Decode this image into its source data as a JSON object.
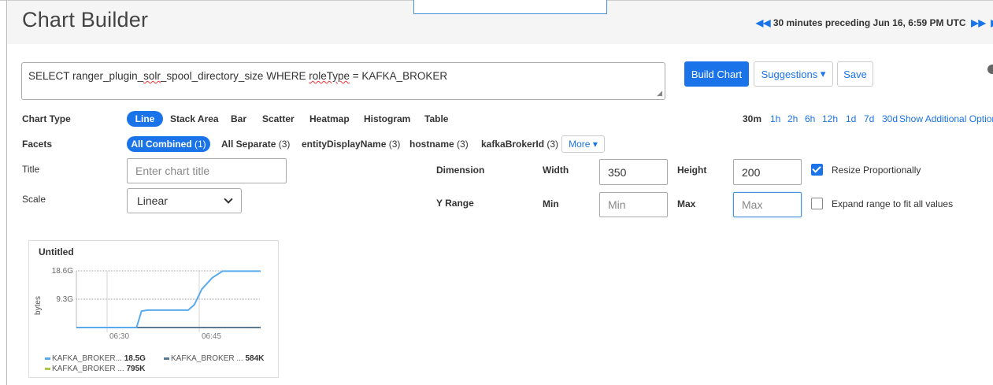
{
  "header": {
    "title": "Chart Builder",
    "time_range": "30 minutes preceding Jun 16, 6:59 PM UTC"
  },
  "query": {
    "before": "SELECT ranger_plugin_",
    "squig1": "solr",
    "middle": "_spool_directory_size WHERE ",
    "squig2": "roleType",
    "after": " = KAFKA_BROKER"
  },
  "toolbar": {
    "build_label": "Build Chart",
    "suggestions_label": "Suggestions",
    "save_label": "Save"
  },
  "chart_type": {
    "label": "Chart Type",
    "options": [
      "Line",
      "Stack Area",
      "Bar",
      "Scatter",
      "Heatmap",
      "Histogram",
      "Table"
    ],
    "selected": "Line"
  },
  "time_ranges": {
    "items": [
      "30m",
      "1h",
      "2h",
      "6h",
      "12h",
      "1d",
      "7d",
      "30d"
    ],
    "active": "30m",
    "more_label": "Show Additional Options"
  },
  "facets": {
    "label": "Facets",
    "items": [
      {
        "name": "All Combined",
        "count": "(1)"
      },
      {
        "name": "All Separate",
        "count": "(3)"
      },
      {
        "name": "entityDisplayName",
        "count": "(3)"
      },
      {
        "name": "hostname",
        "count": "(3)"
      },
      {
        "name": "kafkaBrokerId",
        "count": "(3)"
      }
    ],
    "more_label": "More"
  },
  "form": {
    "title_label": "Title",
    "title_placeholder": "Enter chart title",
    "scale_label": "Scale",
    "scale_value": "Linear",
    "dimension_label": "Dimension",
    "width_label": "Width",
    "width_value": "350",
    "height_label": "Height",
    "height_value": "200",
    "resize_label": "Resize Proportionally",
    "resize_checked": true,
    "yrange_label": "Y Range",
    "min_label": "Min",
    "min_placeholder": "Min",
    "max_label": "Max",
    "max_placeholder": "Max",
    "expand_label": "Expand range to fit all values",
    "expand_checked": false
  },
  "chart_data": {
    "type": "line",
    "title": "Untitled",
    "ylabel": "bytes",
    "yticks": [
      "18.6G",
      "9.3G"
    ],
    "xticks": [
      "06:30",
      "06:45"
    ],
    "ylim": [
      0,
      18.6
    ],
    "xlim": [
      0,
      30
    ],
    "series": [
      {
        "name": "KAFKA_BROKER...",
        "value_label": "18.5G",
        "color": "#5aaaf0",
        "x": [
          0,
          9.8,
          10.6,
          11.6,
          18.2,
          19.2,
          20.4,
          22.1,
          23.8,
          30
        ],
        "y": [
          0,
          0,
          5.4,
          5.7,
          5.7,
          7.5,
          12.5,
          16.3,
          18.5,
          18.5
        ]
      },
      {
        "name": "KAFKA_BROKER ...",
        "value_label": "584K",
        "color": "#5b7a95",
        "x": [
          0,
          30
        ],
        "y": [
          0,
          0
        ]
      },
      {
        "name": "KAFKA_BROKER ...",
        "value_label": "795K",
        "color": "#a8c84a",
        "x": [
          0,
          30
        ],
        "y": [
          0,
          0
        ]
      }
    ]
  }
}
